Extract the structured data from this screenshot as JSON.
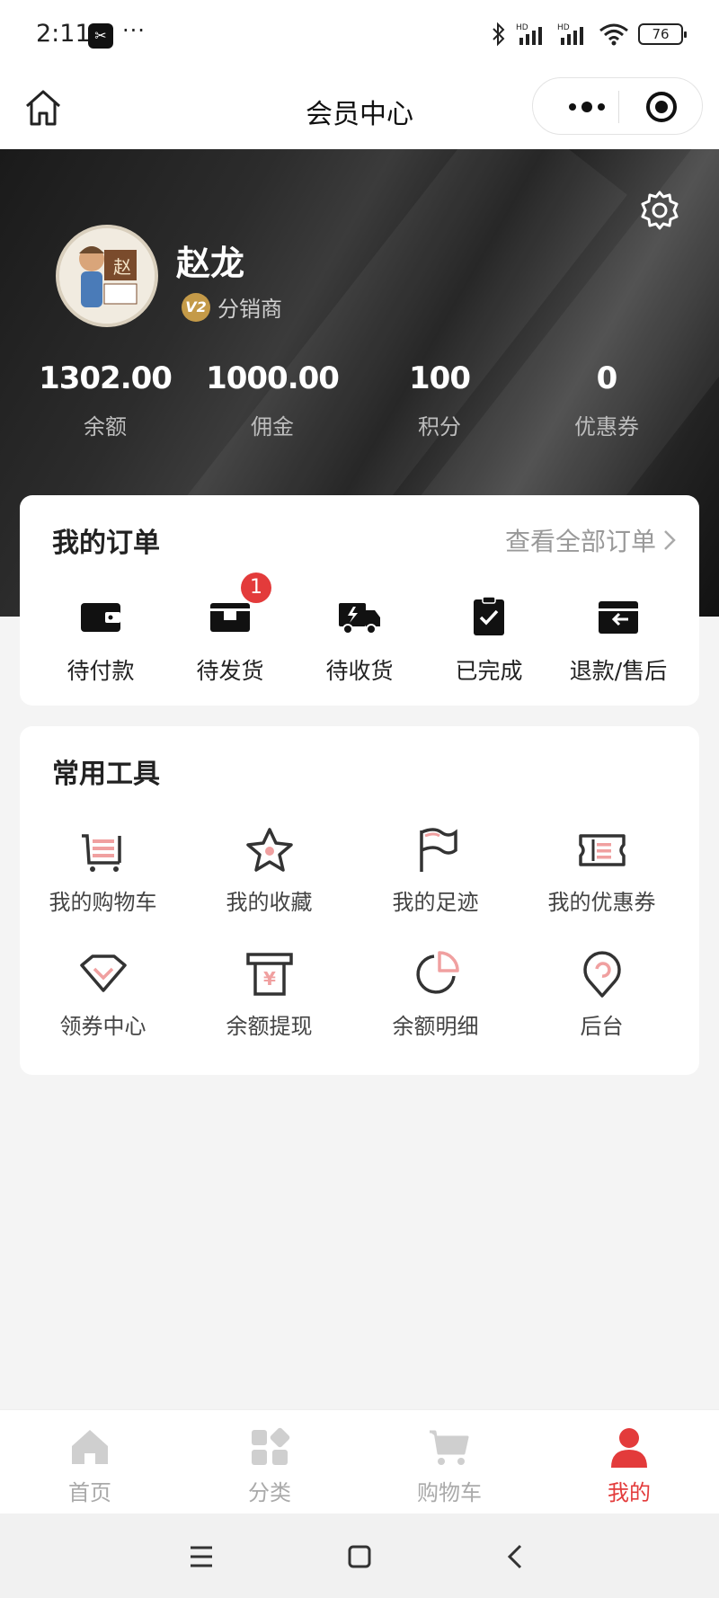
{
  "status_bar": {
    "time": "2:11",
    "app_icon": "capcut-icon",
    "more": "···",
    "network": "HD",
    "battery": "76"
  },
  "nav": {
    "title": "会员中心",
    "home_icon": "home-icon",
    "more_icon": "more-icon",
    "close_icon": "target-icon"
  },
  "profile": {
    "avatar_text": "赵",
    "name": "赵龙",
    "level_badge": "V2",
    "role": "分销商",
    "stats": [
      {
        "value": "1302.00",
        "label": "余额"
      },
      {
        "value": "1000.00",
        "label": "佣金"
      },
      {
        "value": "100",
        "label": "积分"
      },
      {
        "value": "0",
        "label": "优惠券"
      }
    ]
  },
  "orders": {
    "title": "我的订单",
    "view_all": "查看全部订单",
    "items": [
      {
        "label": "待付款",
        "icon": "wallet-icon"
      },
      {
        "label": "待发货",
        "icon": "box-icon",
        "badge": "1"
      },
      {
        "label": "待收货",
        "icon": "truck-icon"
      },
      {
        "label": "已完成",
        "icon": "clipboard-check-icon"
      },
      {
        "label": "退款/售后",
        "icon": "refund-icon"
      }
    ]
  },
  "tools": {
    "title": "常用工具",
    "items": [
      {
        "label": "我的购物车",
        "icon": "cart-icon"
      },
      {
        "label": "我的收藏",
        "icon": "star-icon"
      },
      {
        "label": "我的足迹",
        "icon": "flag-icon"
      },
      {
        "label": "我的优惠券",
        "icon": "ticket-icon"
      },
      {
        "label": "领券中心",
        "icon": "diamond-icon"
      },
      {
        "label": "余额提现",
        "icon": "atm-icon"
      },
      {
        "label": "余额明细",
        "icon": "pie-icon"
      },
      {
        "label": "后台",
        "icon": "location-icon"
      }
    ]
  },
  "tabbar": [
    {
      "label": "首页",
      "icon": "home-icon",
      "active": false
    },
    {
      "label": "分类",
      "icon": "category-icon",
      "active": false
    },
    {
      "label": "购物车",
      "icon": "cart-icon",
      "active": false
    },
    {
      "label": "我的",
      "icon": "user-icon",
      "active": true
    }
  ],
  "colors": {
    "accent": "#e33b3b",
    "hero_dark": "#1a1a1a",
    "icon_pink": "#f0a0a0"
  }
}
